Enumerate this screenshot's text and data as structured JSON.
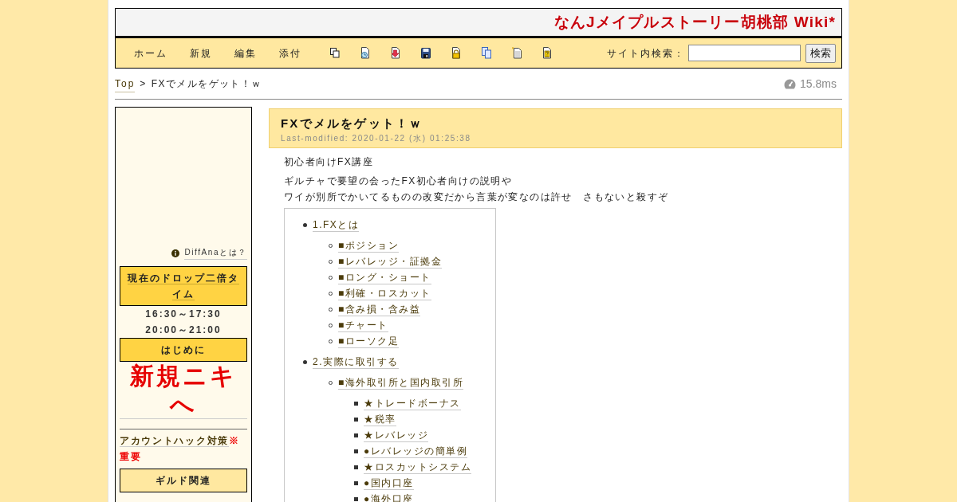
{
  "header": {
    "title": "なんJメイプルストーリー胡桃部 Wiki*"
  },
  "toolbar": {
    "menu": [
      "ホーム",
      "新規",
      "編集",
      "添付"
    ],
    "search": {
      "label": "サイト内検索：",
      "button": "検索"
    }
  },
  "breadcrumb": {
    "link": "Top",
    "separator": ">",
    "current": "FXでメルをゲット！ｗ"
  },
  "render_time": "15.8ms",
  "sidebar": {
    "ad_link": "DiffAnaとは？",
    "blocks": [
      {
        "kind": "heading",
        "text": "現在のドロップ二倍タイム",
        "highlighted": true,
        "linked": true
      },
      {
        "kind": "text",
        "text": "16:30～17:30"
      },
      {
        "kind": "text",
        "text": "20:00～21:00"
      },
      {
        "kind": "heading",
        "text": "はじめに",
        "highlighted": true,
        "linked": false
      },
      {
        "kind": "big_link",
        "text": "新規ニキへ"
      },
      {
        "kind": "divider"
      },
      {
        "kind": "link",
        "text": "アカウントハック対策",
        "note": "※重要"
      },
      {
        "kind": "heading",
        "text": "ギルド関連",
        "highlighted": false,
        "linked": false
      }
    ]
  },
  "page": {
    "title": "FXでメルをゲット！ｗ",
    "last_modified": "Last-modified: 2020-01-22 (水) 01:25:38",
    "paragraphs": [
      [
        "初心者向けFX講座"
      ],
      [
        "ギルチャで要望の会ったFX初心者向けの説明や",
        "ワイが別所でかいてるものの改変だから言葉が変なのは許せ　さもないと殺すぞ"
      ]
    ],
    "contents": [
      {
        "text": "1.FXとは",
        "children": [
          {
            "text": "■ポジション"
          },
          {
            "text": "■レバレッジ・証拠金"
          },
          {
            "text": "■ロング・ショート"
          },
          {
            "text": "■利確・ロスカット"
          },
          {
            "text": "■含み損・含み益"
          },
          {
            "text": "■チャート"
          },
          {
            "text": "■ローソク足"
          }
        ]
      },
      {
        "text": "2.実際に取引する",
        "children": [
          {
            "text": "■海外取引所と国内取引所",
            "children": [
              {
                "text": "★トレードボーナス"
              },
              {
                "text": "★税率"
              },
              {
                "text": "★レバレッジ"
              },
              {
                "text": "●レバレッジの簡単例"
              },
              {
                "text": "★ロスカットシステム"
              },
              {
                "text": "●国内口座"
              },
              {
                "text": "●海外口座"
              }
            ]
          }
        ]
      }
    ]
  }
}
